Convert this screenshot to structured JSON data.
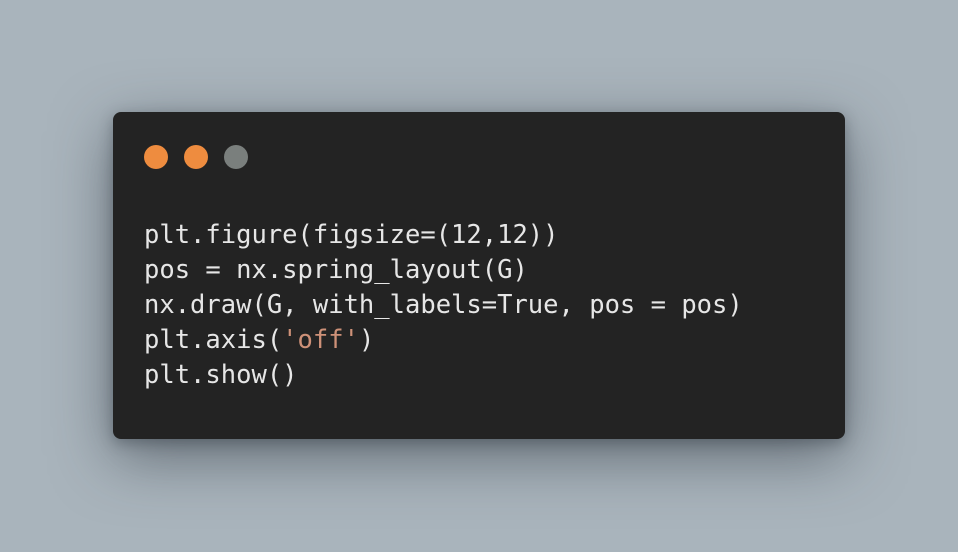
{
  "window": {
    "controls": [
      {
        "name": "close",
        "color": "#ee8c3f"
      },
      {
        "name": "minimize",
        "color": "#ee8c3f"
      },
      {
        "name": "maximize",
        "color": "#7a7f7d"
      }
    ]
  },
  "code": {
    "lines": [
      "plt.figure(figsize=(12,12))",
      "pos = nx.spring_layout(G)",
      "nx.draw(G, with_labels=True, pos = pos)",
      "plt.axis(",
      "'off'",
      ")",
      "plt.show()"
    ]
  },
  "colors": {
    "background": "#a9b4bc",
    "window": "#232323",
    "code_text": "#e6e6e6",
    "string_literal": "#ce9178"
  }
}
